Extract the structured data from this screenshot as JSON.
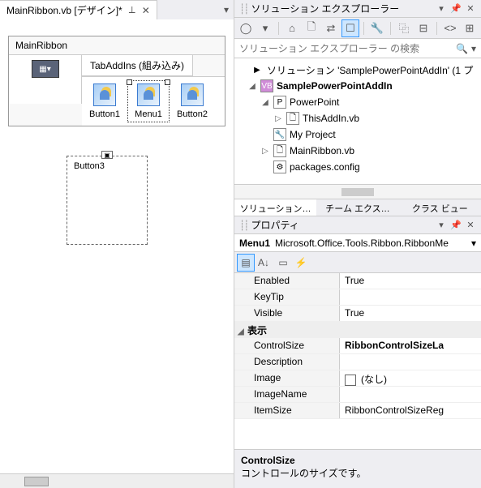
{
  "doc_tab": {
    "title": "MainRibbon.vb [デザイン]*"
  },
  "ribbon": {
    "title": "MainRibbon",
    "tab_label": "TabAddIns (組み込み)",
    "buttons": [
      "Button1",
      "Menu1",
      "Button2"
    ],
    "dropdown_item": "Button3"
  },
  "solution_explorer": {
    "title": "ソリューション エクスプローラー",
    "search_placeholder": "ソリューション エクスプローラー の検索",
    "solution_line": "ソリューション 'SamplePowerPointAddIn' (1 プ",
    "nodes": {
      "project": "SamplePowerPointAddIn",
      "pp": "PowerPoint",
      "thisaddin": "ThisAddIn.vb",
      "myproject": "My Project",
      "mainribbon": "MainRibbon.vb",
      "packages": "packages.config"
    },
    "tabs": [
      "ソリューション…",
      "チーム エクス…",
      "クラス ビュー"
    ]
  },
  "properties": {
    "title": "プロパティ",
    "object_name": "Menu1",
    "object_type": "Microsoft.Office.Tools.Ribbon.RibbonMe",
    "rows": {
      "enabled_k": "Enabled",
      "enabled_v": "True",
      "keytip_k": "KeyTip",
      "keytip_v": "",
      "visible_k": "Visible",
      "visible_v": "True",
      "cat_display": "表示",
      "controlsize_k": "ControlSize",
      "controlsize_v": "RibbonControlSizeLa",
      "description_k": "Description",
      "description_v": "",
      "image_k": "Image",
      "image_v": "(なし)",
      "imagename_k": "ImageName",
      "imagename_v": "",
      "itemsize_k": "ItemSize",
      "itemsize_v": "RibbonControlSizeReg"
    },
    "help_name": "ControlSize",
    "help_desc": "コントロールのサイズです。"
  }
}
